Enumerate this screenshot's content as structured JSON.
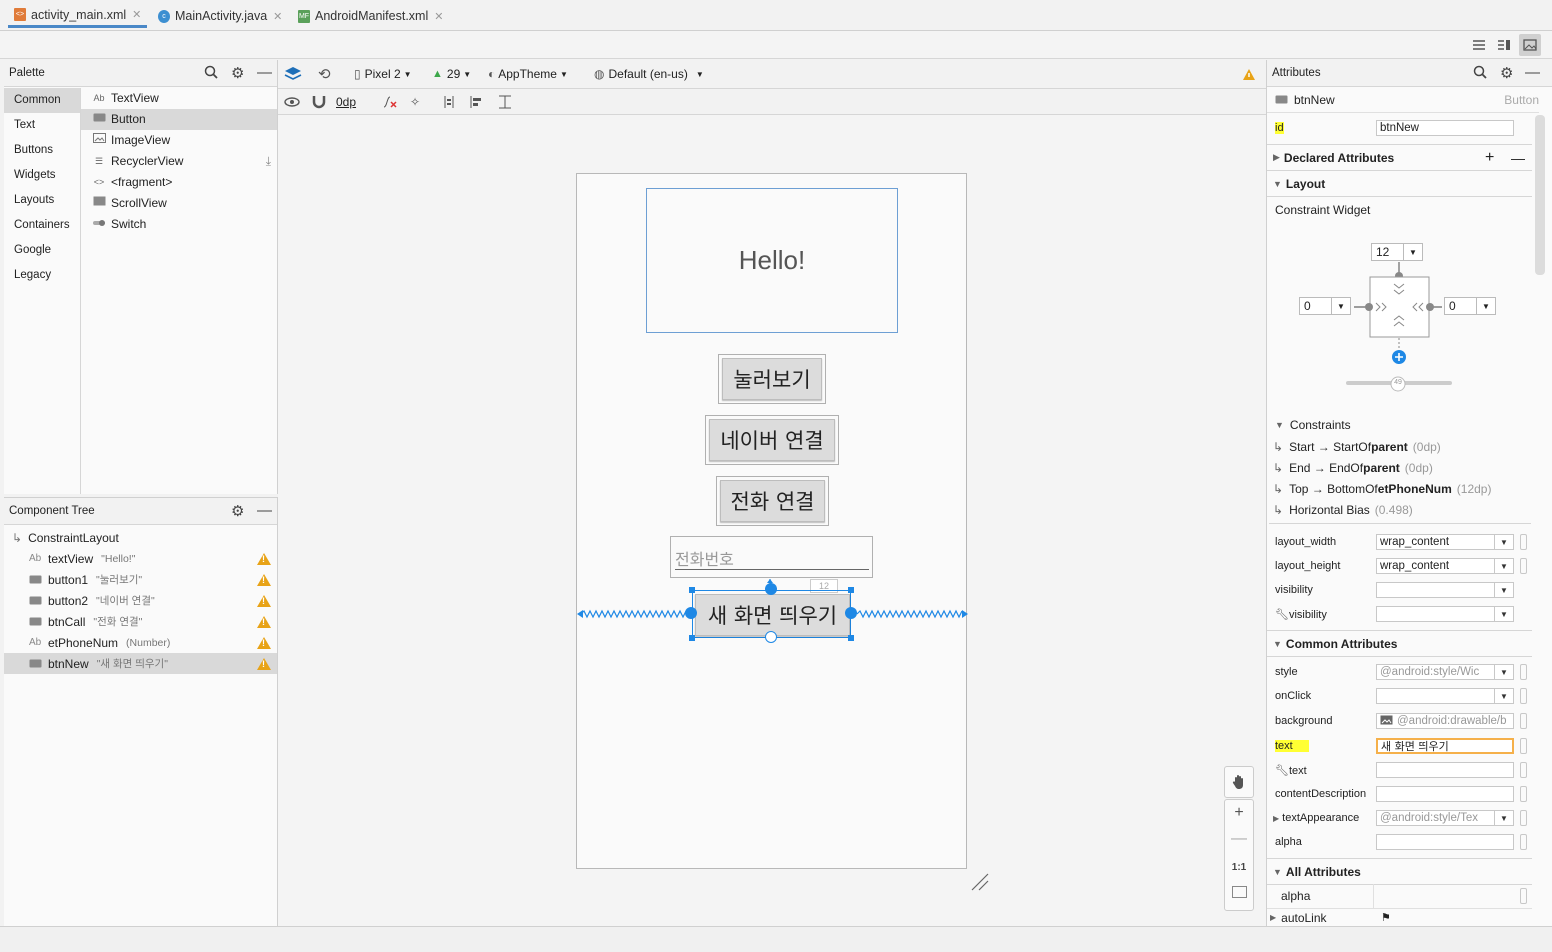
{
  "tabs": [
    {
      "label": "activity_main.xml",
      "active": true
    },
    {
      "label": "MainActivity.java",
      "active": false
    },
    {
      "label": "AndroidManifest.xml",
      "active": false
    }
  ],
  "palette": {
    "title": "Palette",
    "categories": [
      "Common",
      "Text",
      "Buttons",
      "Widgets",
      "Layouts",
      "Containers",
      "Google",
      "Legacy"
    ],
    "items": [
      "TextView",
      "Button",
      "ImageView",
      "RecyclerView",
      "<fragment>",
      "ScrollView",
      "Switch"
    ],
    "item_icon_text": "Ab"
  },
  "component_tree": {
    "title": "Component Tree",
    "root": "ConstraintLayout",
    "items": [
      {
        "id": "textView",
        "desc": "\"Hello!\"",
        "icon": "Ab"
      },
      {
        "id": "button1",
        "desc": "\"눌러보기\"",
        "icon": ""
      },
      {
        "id": "button2",
        "desc": "\"네이버 연결\"",
        "icon": ""
      },
      {
        "id": "btnCall",
        "desc": "\"전화 연결\"",
        "icon": ""
      },
      {
        "id": "etPhoneNum",
        "desc": "(Number)",
        "icon": "Ab"
      },
      {
        "id": "btnNew",
        "desc": "\"새 화면 띄우기\"",
        "icon": ""
      }
    ]
  },
  "toolbar": {
    "device": "Pixel 2",
    "api": "29",
    "theme": "AppTheme",
    "locale": "Default (en-us)",
    "margin": "0dp"
  },
  "design": {
    "hello_text": "Hello!",
    "button1": "눌러보기",
    "button2": "네이버 연결",
    "btncall": "전화 연결",
    "phone_hint": "전화번호",
    "btnnew": "새 화면 띄우기",
    "margin_label": "12"
  },
  "attributes": {
    "title": "Attributes",
    "widget_name": "btnNew",
    "widget_type": "Button",
    "id_label": "id",
    "id_value": "btnNew",
    "declared_title": "Declared Attributes",
    "layout_title": "Layout",
    "constraint_widget": "Constraint Widget",
    "margin_top": "12",
    "margin_left": "0",
    "margin_right": "0",
    "bias": "49",
    "constraints_title": "Constraints",
    "constraints": [
      {
        "text": "Start → StartOf ",
        "bold": "parent",
        "gray": "(0dp)"
      },
      {
        "text": "End → EndOf ",
        "bold": "parent",
        "gray": "(0dp)"
      },
      {
        "text": "Top → BottomOf ",
        "bold": "etPhoneNum",
        "gray": "(12dp)"
      },
      {
        "text": "Horizontal Bias",
        "bold": "",
        "gray": "(0.498)"
      }
    ],
    "layout_rows": [
      {
        "label": "layout_width",
        "value": "wrap_content"
      },
      {
        "label": "layout_height",
        "value": "wrap_content"
      },
      {
        "label": "visibility",
        "value": ""
      },
      {
        "label": "visibility",
        "value": ""
      }
    ],
    "common_title": "Common Attributes",
    "common_rows": [
      {
        "label": "style",
        "value": "@android:style/Wic"
      },
      {
        "label": "onClick",
        "value": ""
      },
      {
        "label": "background",
        "value": "@android:drawable/b"
      },
      {
        "label": "text",
        "value": "새 화면 띄우기"
      },
      {
        "label": "text",
        "value": ""
      },
      {
        "label": "contentDescription",
        "value": ""
      },
      {
        "label": "textAppearance",
        "value": "@android:style/Tex"
      },
      {
        "label": "alpha",
        "value": ""
      }
    ],
    "all_title": "All Attributes",
    "all_rows": [
      "alpha",
      "autoLink"
    ]
  },
  "zoom": {
    "fit_label": "1:1"
  },
  "colors": {
    "accent": "#1e88e5",
    "highlight": "#ffff33",
    "warning": "#e8a317"
  }
}
